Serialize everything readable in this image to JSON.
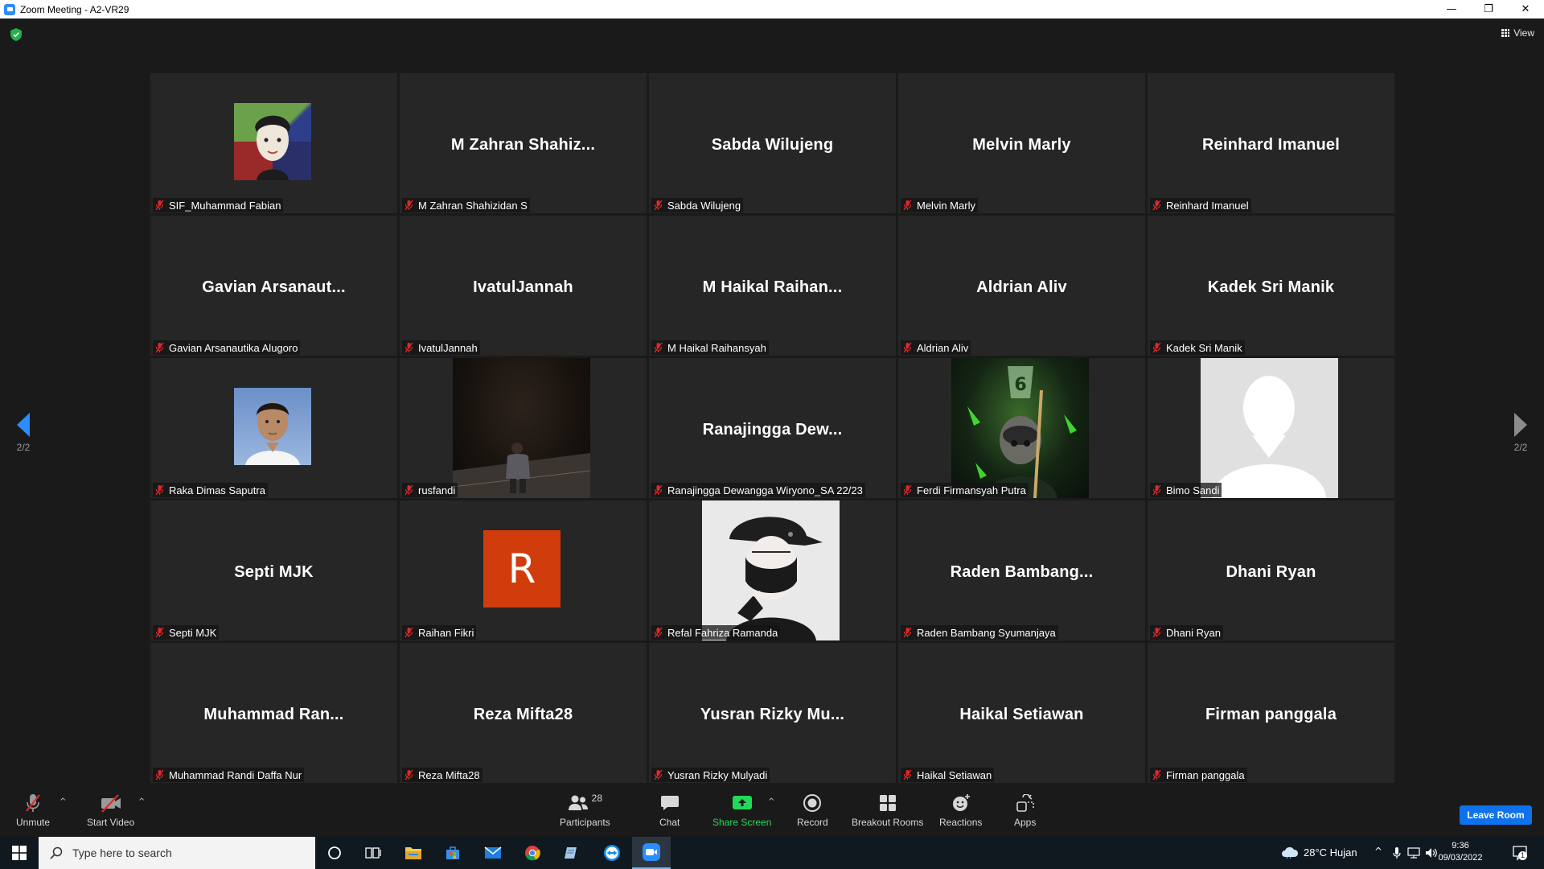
{
  "window": {
    "title": "Zoom Meeting - A2-VR29",
    "controls": [
      "—",
      "❐",
      "✕"
    ]
  },
  "meeting": {
    "view_label": "View",
    "page_left": "2/2",
    "page_right": "2/2"
  },
  "tiles": [
    {
      "big": "",
      "label": "SIF_Muhammad Fabian",
      "avatar": "fabian"
    },
    {
      "big": "M  Zahran  Shahiz...",
      "label": "M Zahran Shahizidan S"
    },
    {
      "big": "Sabda Wilujeng",
      "label": "Sabda Wilujeng"
    },
    {
      "big": "Melvin Marly",
      "label": "Melvin Marly"
    },
    {
      "big": "Reinhard Imanuel",
      "label": "Reinhard Imanuel"
    },
    {
      "big": "Gavian  Arsanaut...",
      "label": "Gavian Arsanautika Alugoro"
    },
    {
      "big": "IvatulJannah",
      "label": "IvatulJannah"
    },
    {
      "big": "M  Haikal  Raihan...",
      "label": "M Haikal Raihansyah"
    },
    {
      "big": "Aldrian Aliv",
      "label": "Aldrian Aliv"
    },
    {
      "big": "Kadek Sri Manik",
      "label": "Kadek Sri Manik"
    },
    {
      "big": "",
      "label": "Raka Dimas Saputra",
      "avatar": "raka"
    },
    {
      "big": "",
      "label": "rusfandi",
      "avatar": "rusfandi"
    },
    {
      "big": "Ranajingga  Dew...",
      "label": "Ranajingga Dewangga Wiryono_SA 22/23"
    },
    {
      "big": "",
      "label": "Ferdi Firmansyah Putra",
      "avatar": "ferdi"
    },
    {
      "big": "",
      "label": "Bimo Sandi",
      "avatar": "bimo"
    },
    {
      "big": "Septi MJK",
      "label": "Septi MJK"
    },
    {
      "big": "",
      "label": "Raihan Fikri",
      "avatar": "letter",
      "letter": "R"
    },
    {
      "big": "",
      "label": "Refal Fahriza Ramanda",
      "avatar": "refal"
    },
    {
      "big": "Raden  Bambang...",
      "label": "Raden Bambang Syumanjaya"
    },
    {
      "big": "Dhani Ryan",
      "label": "Dhani Ryan"
    },
    {
      "big": "Muhammad  Ran...",
      "label": "Muhammad Randi Daffa Nur"
    },
    {
      "big": "Reza Mifta28",
      "label": "Reza Mifta28"
    },
    {
      "big": "Yusran  Rizky  Mu...",
      "label": "Yusran Rizky Mulyadi"
    },
    {
      "big": "Haikal Setiawan",
      "label": "Haikal Setiawan"
    },
    {
      "big": "Firman panggala",
      "label": "Firman panggala"
    }
  ],
  "toolbar": {
    "unmute": "Unmute",
    "start_video": "Start Video",
    "participants": "Participants",
    "participants_count": "28",
    "chat": "Chat",
    "share_screen": "Share Screen",
    "record": "Record",
    "breakout_rooms": "Breakout Rooms",
    "reactions": "Reactions",
    "apps": "Apps",
    "leave": "Leave Room"
  },
  "taskbar": {
    "search_placeholder": "Type here to search",
    "weather": "28°C  Hujan",
    "time": "9:36",
    "date": "09/03/2022",
    "notification_count": "1"
  },
  "colors": {
    "accent": "#2d8cff",
    "share_green": "#23d959",
    "muted_red": "#e02828",
    "leave_blue": "#0e72ed"
  }
}
